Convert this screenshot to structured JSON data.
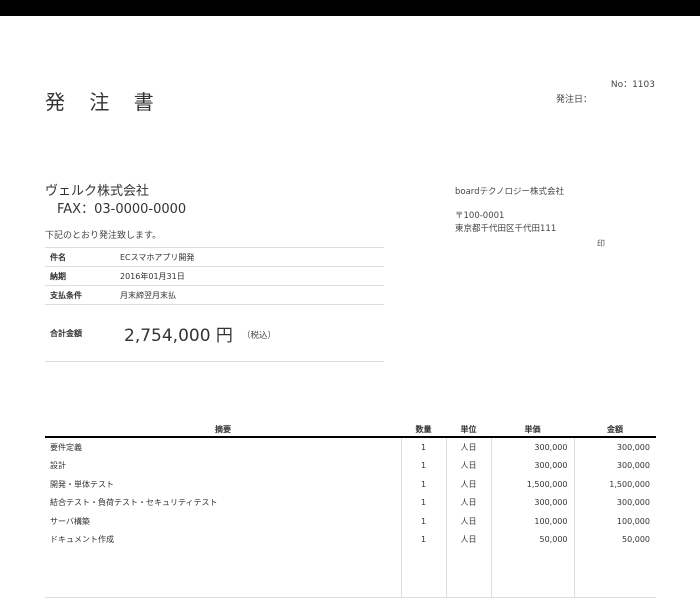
{
  "document": {
    "title": "発 注 書",
    "number": "No：1103",
    "issue_date_label": "発注日："
  },
  "recipient": {
    "name": "ヴェルク株式会社",
    "fax": "FAX：03-0000-0000",
    "intro": "下記のとおり発注致します。"
  },
  "sender": {
    "company": "boardテクノロジー株式会社",
    "postal": "〒100-0001",
    "address": "東京都千代田区千代田111",
    "seal": "印"
  },
  "info": [
    {
      "label": "件名",
      "value": "ECスマホアプリ開発"
    },
    {
      "label": "納期",
      "value": "2016年01月31日"
    },
    {
      "label": "支払条件",
      "value": "月末締翌月末払"
    }
  ],
  "total": {
    "label": "合計金額",
    "amount": "2,754,000 円",
    "tax_note": "（税込）"
  },
  "items_table": {
    "headers": {
      "desc": "摘要",
      "qty": "数量",
      "unit": "単位",
      "price": "単価",
      "amount": "金額"
    },
    "rows": [
      {
        "desc": "要件定義",
        "qty": "1",
        "unit": "人日",
        "price": "300,000",
        "amount": "300,000"
      },
      {
        "desc": "設計",
        "qty": "1",
        "unit": "人日",
        "price": "300,000",
        "amount": "300,000"
      },
      {
        "desc": "開発・単体テスト",
        "qty": "1",
        "unit": "人日",
        "price": "1,500,000",
        "amount": "1,500,000"
      },
      {
        "desc": "結合テスト・負荷テスト・セキュリティテスト",
        "qty": "1",
        "unit": "人日",
        "price": "300,000",
        "amount": "300,000"
      },
      {
        "desc": "サーバ構築",
        "qty": "1",
        "unit": "人日",
        "price": "100,000",
        "amount": "100,000"
      },
      {
        "desc": "ドキュメント作成",
        "qty": "1",
        "unit": "人日",
        "price": "50,000",
        "amount": "50,000"
      }
    ]
  },
  "colors": {
    "top_bar": "#000000",
    "text": "#333333",
    "rule": "#dddddd"
  }
}
